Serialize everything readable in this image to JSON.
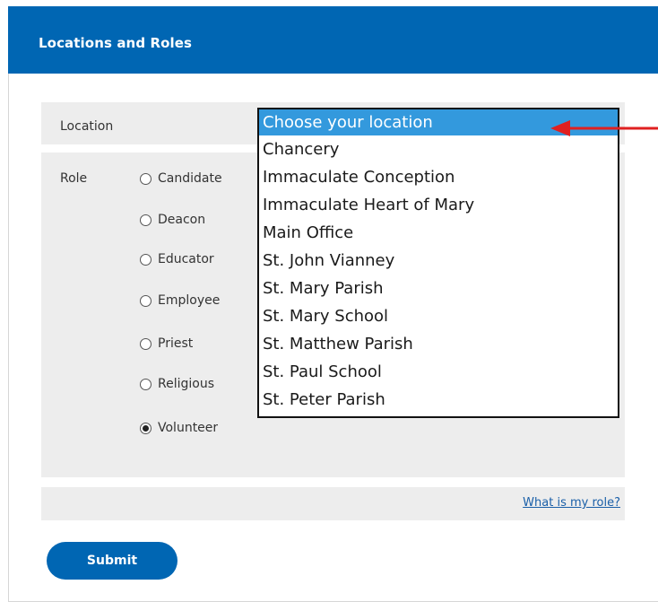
{
  "header": {
    "title": "Locations and Roles"
  },
  "location": {
    "label": "Location",
    "options": [
      "Choose your location",
      "Chancery",
      "Immaculate Conception",
      "Immaculate Heart of Mary",
      "Main Office",
      "St. John Vianney",
      "St. Mary Parish",
      "St. Mary School",
      "St. Matthew Parish",
      "St. Paul School",
      "St. Peter Parish"
    ],
    "selected": "Choose your location"
  },
  "role": {
    "label": "Role",
    "options": [
      {
        "label": "Candidate",
        "checked": false
      },
      {
        "label": "Deacon",
        "checked": false
      },
      {
        "label": "Educator",
        "checked": false
      },
      {
        "label": "Employee",
        "checked": false
      },
      {
        "label": "Priest",
        "checked": false
      },
      {
        "label": "Religious",
        "checked": false
      },
      {
        "label": "Volunteer",
        "checked": true
      }
    ]
  },
  "help": {
    "link_label": "What is my role?"
  },
  "submit": {
    "label": "Submit"
  },
  "colors": {
    "brand": "#0066b3",
    "highlight": "#3399dd",
    "arrow": "#e02020"
  }
}
